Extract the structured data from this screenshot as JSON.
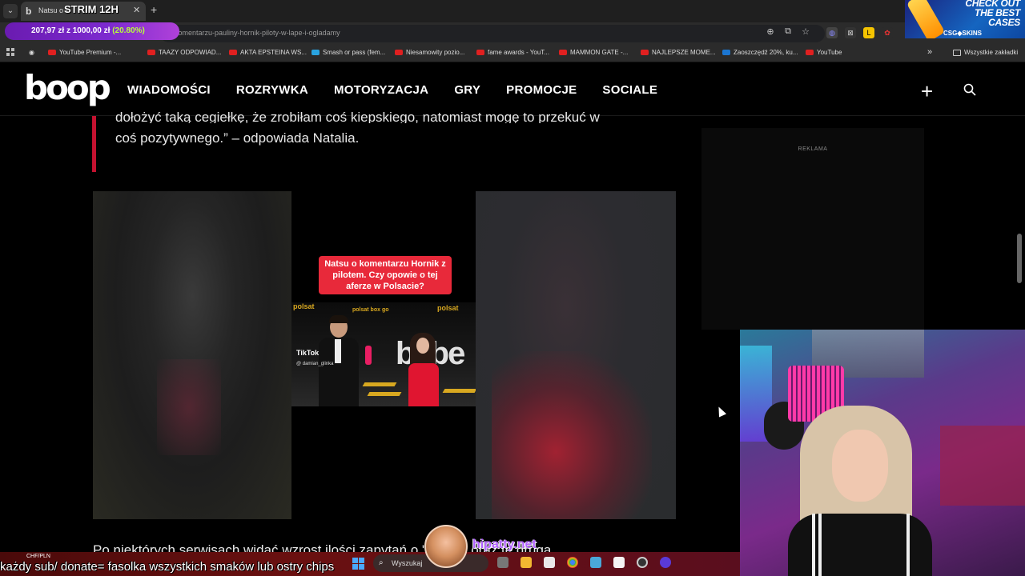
{
  "browser": {
    "tab_title": "Natsu o k",
    "stream_title": "STRIM 12H",
    "url": "komentarzu-pauliny-hornik-piloty-w-lape-i-ogladamy",
    "donation_amount": "207,97 zł",
    "donation_of": "z",
    "donation_goal": "1000,00 zł",
    "donation_pct": "(20.80%)"
  },
  "bookmarks": [
    {
      "label": "YouTube Premium -..."
    },
    {
      "label": "TAAZY ODPOWIAD..."
    },
    {
      "label": "AKTA EPSTEINA WS..."
    },
    {
      "label": "Smash or pass (fem..."
    },
    {
      "label": "Niesamowity pozio..."
    },
    {
      "label": "fame awards - YouT..."
    },
    {
      "label": "MAMMON GATE -..."
    },
    {
      "label": "NAJLEPSZE MOME..."
    },
    {
      "label": "Zaoszczędź 20%, ku..."
    },
    {
      "label": "YouTube"
    }
  ],
  "bookmarks_more": "»",
  "bookmarks_all": "Wszystkie zakładki",
  "ad_banner": {
    "line1": "CHECK OUT",
    "line2": "THE BEST",
    "line3": "CASES",
    "brand": "CSG◆SKINS"
  },
  "site": {
    "logo": "boop",
    "nav": [
      "WIADOMOŚCI",
      "ROZRYWKA",
      "MOTORYZACJA",
      "GRY",
      "PROMOCJE",
      "SOCIALE"
    ]
  },
  "article": {
    "quote_line1": "dołożyć taką cegiełkę, że zrobiłam coś kiepskiego, natomiast mogę to przekuć w",
    "quote_line2": "coś pozytywnego.” – odpowiada Natalia.",
    "video_caption": "Natsu o komentarzu Hornik z pilotem. Czy opowie o tej aferze w Polsacie?",
    "video_watermark": "TikTok",
    "video_handle": "@ damian_glinka",
    "backdrop_left": "polsat",
    "backdrop_center": "polsat box go",
    "backdrop_right": "polsat",
    "backdrop_big": "bebe",
    "cut_paragraph": "Po niektórych serwisach widać wzrost ilości zapytań o \"Natsu\" oraz te druga"
  },
  "sidebar": {
    "ad_label": "REKLAMA"
  },
  "overlay": {
    "currency": "CHF/PLN",
    "taskbar_search": "Wyszukaj",
    "ticker": "każdy sub/ donate= fasolka wszystkich smaków lub ostry chips",
    "streamer_name": "hipatty.net"
  },
  "colors": {
    "quote_accent": "#c41230",
    "caption_bg": "#e8293a",
    "donation_pct": "#b8ff3a"
  }
}
